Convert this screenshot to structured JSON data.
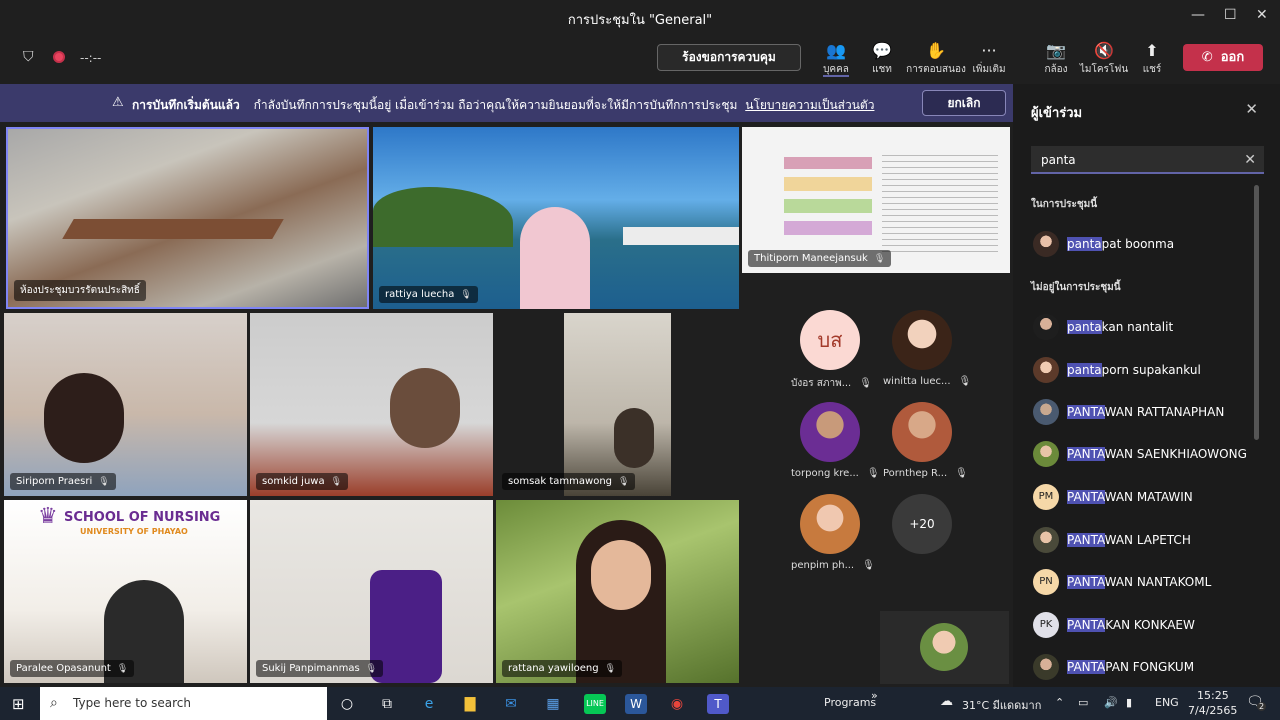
{
  "window": {
    "title": "การประชุมใน \"General\""
  },
  "toolbar": {
    "timer": "--:--",
    "request_control": "ร้องขอการควบคุม",
    "people": "บุคคล",
    "chat": "แชท",
    "reactions": "การตอบสนอง",
    "more": "เพิ่มเติม",
    "camera": "กล้อง",
    "mic": "ไมโครโฟน",
    "share": "แชร์",
    "leave": "ออก"
  },
  "banner": {
    "title": "การบันทึกเริ่มต้นแล้ว",
    "message": "กำลังบันทึกการประชุมนี้อยู่ เมื่อเข้าร่วม ถือว่าคุณให้ความยินยอมที่จะให้มีการบันทึกการประชุม",
    "policy_link": "นโยบายความเป็นส่วนตัว",
    "dismiss": "ยกเลิก"
  },
  "videos": [
    {
      "name": "ห้องประชุมบวรรัตนประสิทธิ์"
    },
    {
      "name": "rattiya luecha"
    },
    {
      "name": "Thitiporn Maneejansuk"
    },
    {
      "name": "Siriporn Praesri"
    },
    {
      "name": "somkid juwa"
    },
    {
      "name": "somsak tammawong"
    },
    {
      "name": "Paralee Opasanunt"
    },
    {
      "name": "Sukij Panpimanmas"
    },
    {
      "name": "rattana yawiloeng"
    }
  ],
  "nursing": {
    "line1": "SCHOOL OF NURSING",
    "line2": "UNIVERSITY OF PHAYAO"
  },
  "attendees": [
    {
      "initials": "บส",
      "name": "บังอร สภาพ..."
    },
    {
      "name": "winitta luec..."
    },
    {
      "name": "torpong kre..."
    },
    {
      "name": "Pornthep R..."
    },
    {
      "name": "penpim ph..."
    }
  ],
  "overflow_count": "+20",
  "panel": {
    "title": "ผู้เข้าร่วม",
    "search_value": "panta",
    "in_meeting": "ในการประชุมนี้",
    "not_in_meeting": "ไม่อยู่ในการประชุมนี้",
    "people_in": [
      {
        "match": "panta",
        "rest": "pat boonma"
      }
    ],
    "people_out": [
      {
        "match": "panta",
        "rest": "kan nantalit"
      },
      {
        "match": "panta",
        "rest": "porn supakankul"
      },
      {
        "match": "PANTA",
        "rest": "WAN RATTANAPHAN"
      },
      {
        "match": "PANTA",
        "rest": "WAN SAENKHIAOWONG"
      },
      {
        "initials": "PM",
        "match": "PANTA",
        "rest": "WAN MATAWIN"
      },
      {
        "match": "PANTA",
        "rest": "WAN LAPETCH"
      },
      {
        "initials": "PN",
        "match": "PANTA",
        "rest": "WAN NANTAKOML"
      },
      {
        "initials": "PK",
        "match": "PANTA",
        "rest": "KAN KONKAEW"
      },
      {
        "match": "PANTA",
        "rest": "PAN FONGKUM"
      }
    ]
  },
  "taskbar": {
    "search_placeholder": "Type here to search",
    "programs": "Programs",
    "weather": "31°C มีแดดมาก",
    "lang": "ENG",
    "time": "15:25",
    "date": "7/4/2565",
    "notifications": "2"
  },
  "colors": {
    "accent": "#6264a7",
    "leave": "#c4314b",
    "banner": "#3b3a6b"
  }
}
